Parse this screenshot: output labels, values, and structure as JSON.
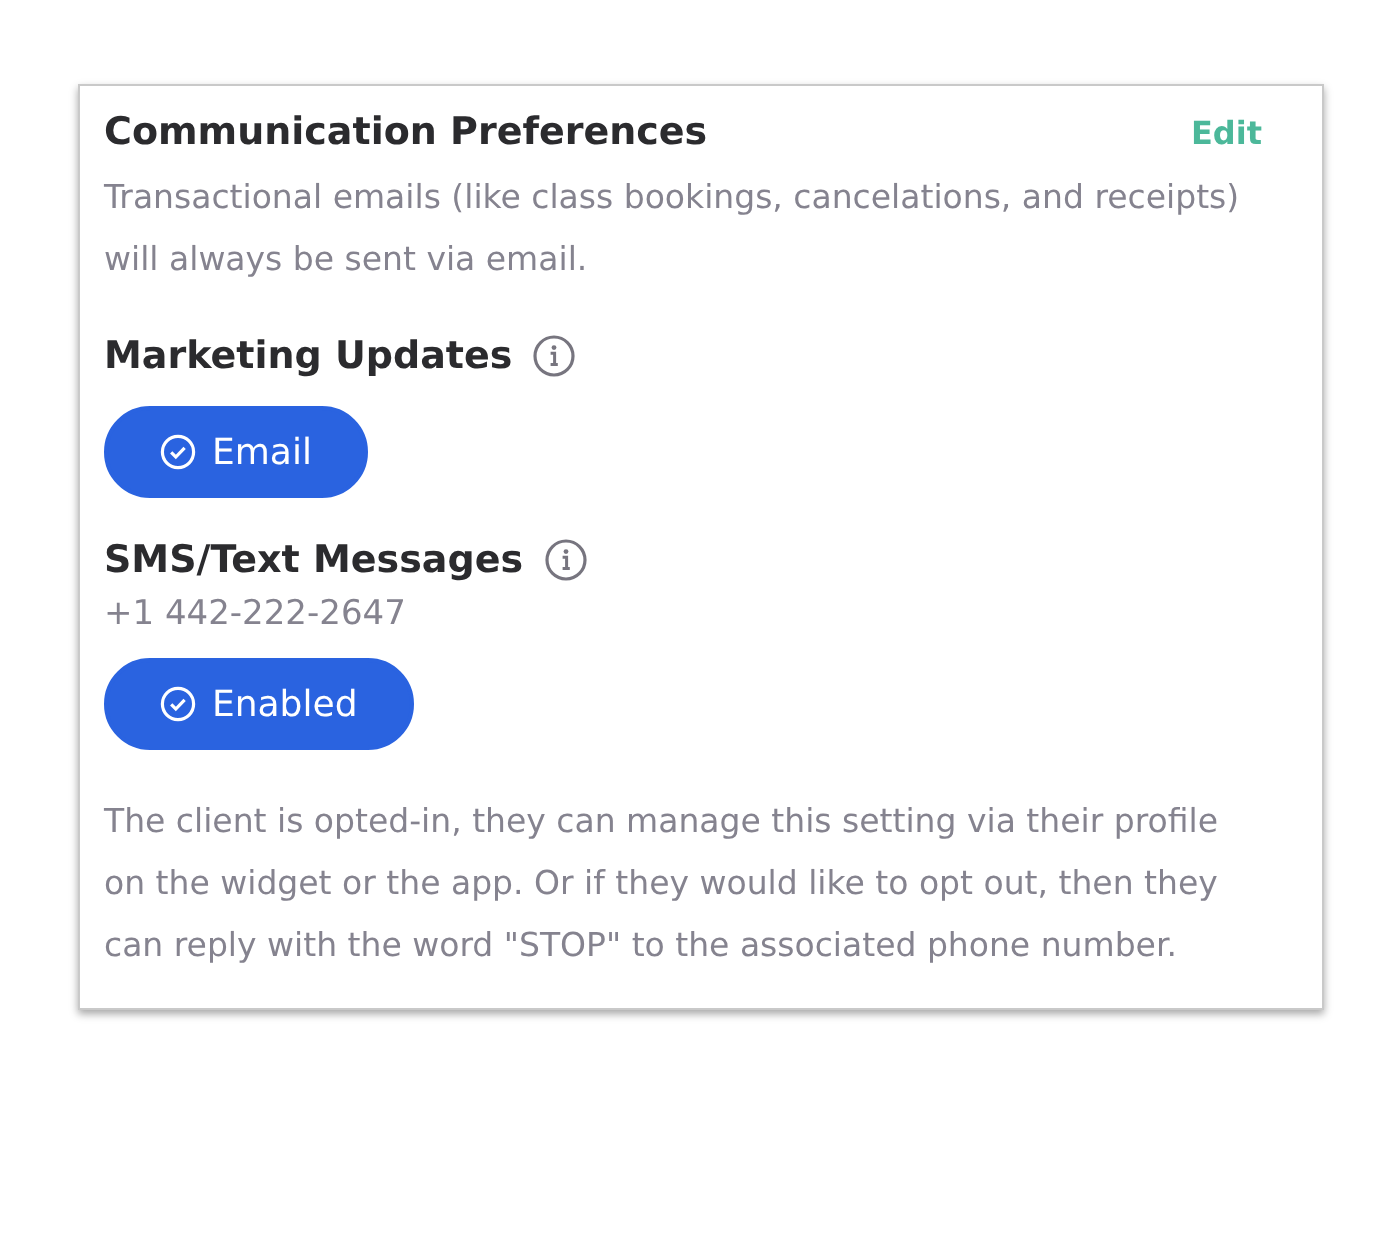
{
  "card": {
    "title": "Communication Preferences",
    "edit_link": "Edit",
    "intro": "Transactional emails (like class bookings, cancelations, and receipts) will always be sent via email."
  },
  "sections": [
    {
      "heading": "Marketing Updates",
      "toggle": {
        "label": "Email",
        "on": true
      }
    },
    {
      "heading": "SMS/Text Messages",
      "phone": "+1 442-222-2647",
      "toggle": {
        "label": "Enabled",
        "on": true
      },
      "note": "The client is opted-in, they can manage this setting via their profile on the widget or the app. Or if they would like to opt out, then they can reply with the word \"STOP\" to the associated phone number."
    }
  ]
}
